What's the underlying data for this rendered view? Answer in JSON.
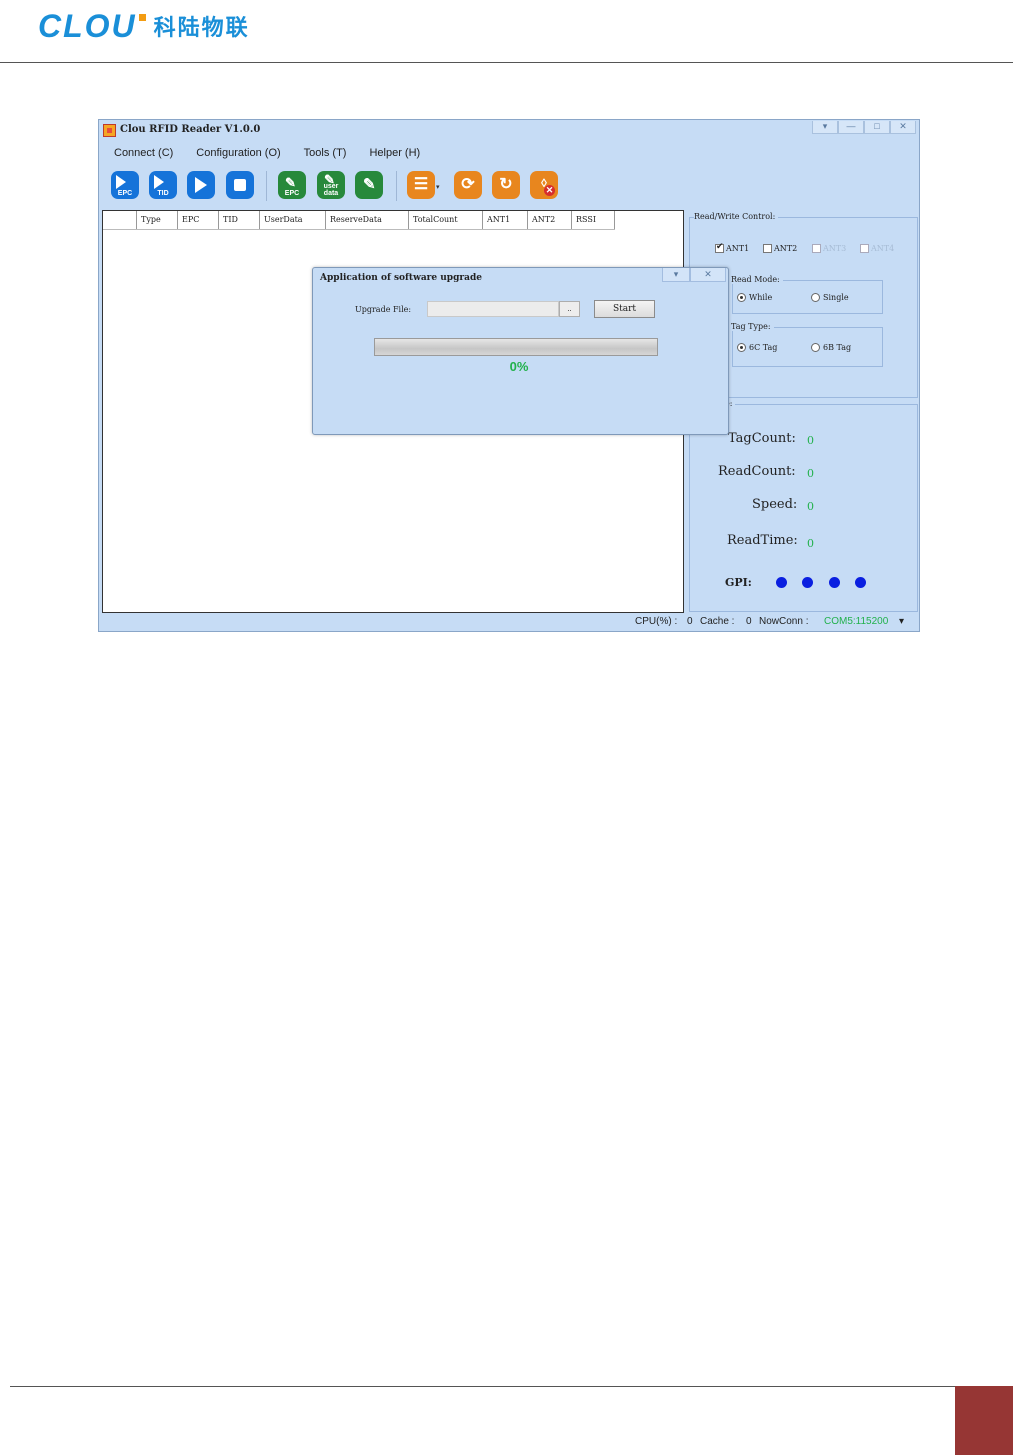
{
  "document": {
    "logo_latin": "CLOU",
    "logo_cn": "科陆物联"
  },
  "window": {
    "title": "Clou RFID Reader V1.0.0",
    "controls": [
      "▾",
      "—",
      "□",
      "✕"
    ]
  },
  "menu": [
    "Connect (C)",
    "Configuration (O)",
    "Tools (T)",
    "Helper (H)"
  ],
  "toolbar": {
    "epc_read_label": "EPC",
    "tid_read_label": "TID",
    "write_epc_label": "EPC",
    "write_userdata_label_line1": "user",
    "write_userdata_label_line2": "data"
  },
  "grid": {
    "columns": [
      "",
      "Type",
      "EPC",
      "TID",
      "UserData",
      "ReserveData",
      "TotalCount",
      "ANT1",
      "ANT2",
      "RSSI"
    ]
  },
  "read_write_control": {
    "title": "Read/Write Control:",
    "antennas": [
      {
        "label": "ANT1",
        "checked": true,
        "enabled": true
      },
      {
        "label": "ANT2",
        "checked": false,
        "enabled": true
      },
      {
        "label": "ANT3",
        "checked": false,
        "enabled": false
      },
      {
        "label": "ANT4",
        "checked": false,
        "enabled": false
      }
    ],
    "read_mode": {
      "title": "Read Mode:",
      "options": [
        "While",
        "Single"
      ],
      "selected": "While"
    },
    "tag_type": {
      "title": "Tag Type:",
      "options": [
        "6C Tag",
        "6B Tag"
      ],
      "selected": "6C Tag"
    }
  },
  "message": {
    "title": "Message:",
    "tag_count_label": "TagCount:",
    "tag_count_value": "0",
    "read_count_label": "ReadCount:",
    "read_count_value": "0",
    "speed_label": "Speed:",
    "speed_value": "0",
    "read_time_label": "ReadTime:",
    "read_time_value": "0",
    "gpi_label": "GPI:",
    "gpi_color": "#0a1fe0"
  },
  "statusbar": {
    "cpu_label": "CPU(%) :",
    "cpu_value": "0",
    "cache_label": "Cache :",
    "cache_value": "0",
    "nowconn_label": "NowConn :",
    "nowconn_value": "COM5:115200",
    "caret": "▾"
  },
  "dialog": {
    "title": "Application of software upgrade",
    "controls": [
      "▾",
      "✕"
    ],
    "upgrade_file_label": "Upgrade File:",
    "upgrade_file_value": "",
    "browse_label": "..",
    "start_label": "Start",
    "progress_fraction": 0,
    "progress_text": "0%"
  }
}
